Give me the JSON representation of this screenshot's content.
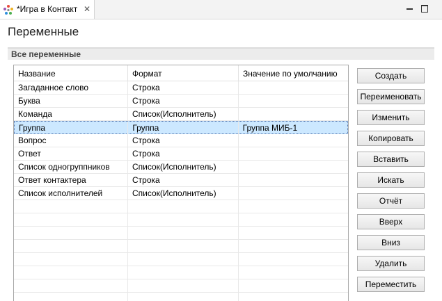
{
  "editor_tab": {
    "title": "*Игра в Контакт",
    "icon": "app-logo-icon",
    "close_glyph": "✕"
  },
  "window_controls": {
    "minimize_icon": "minimize-icon",
    "maximize_icon": "maximize-icon"
  },
  "page": {
    "title": "Переменные",
    "section_title": "Все переменные"
  },
  "table": {
    "columns": [
      "Название",
      "Формат",
      "Значение по умолчанию"
    ],
    "rows": [
      [
        "Загаданное слово",
        "Строка",
        ""
      ],
      [
        "Буква",
        "Строка",
        ""
      ],
      [
        "Команда",
        "Список(Исполнитель)",
        ""
      ],
      [
        "Группа",
        "Группа",
        "Группа МИБ-1"
      ],
      [
        "Вопрос",
        "Строка",
        ""
      ],
      [
        "Ответ",
        "Строка",
        ""
      ],
      [
        "Список одногруппников",
        "Список(Исполнитель)",
        ""
      ],
      [
        "Ответ контактера",
        "Строка",
        ""
      ],
      [
        "Список исполнителей",
        "Список(Исполнитель)",
        ""
      ]
    ],
    "selected_row": 3
  },
  "buttons": {
    "create": "Создать",
    "rename": "Переименовать",
    "edit": "Изменить",
    "copy": "Копировать",
    "paste": "Вставить",
    "search": "Искать",
    "report": "Отчёт",
    "up": "Вверх",
    "down": "Вниз",
    "delete": "Удалить",
    "move": "Переместить"
  },
  "colors": {
    "selection": "#cce8ff",
    "selection_border": "#4b6ea8"
  }
}
